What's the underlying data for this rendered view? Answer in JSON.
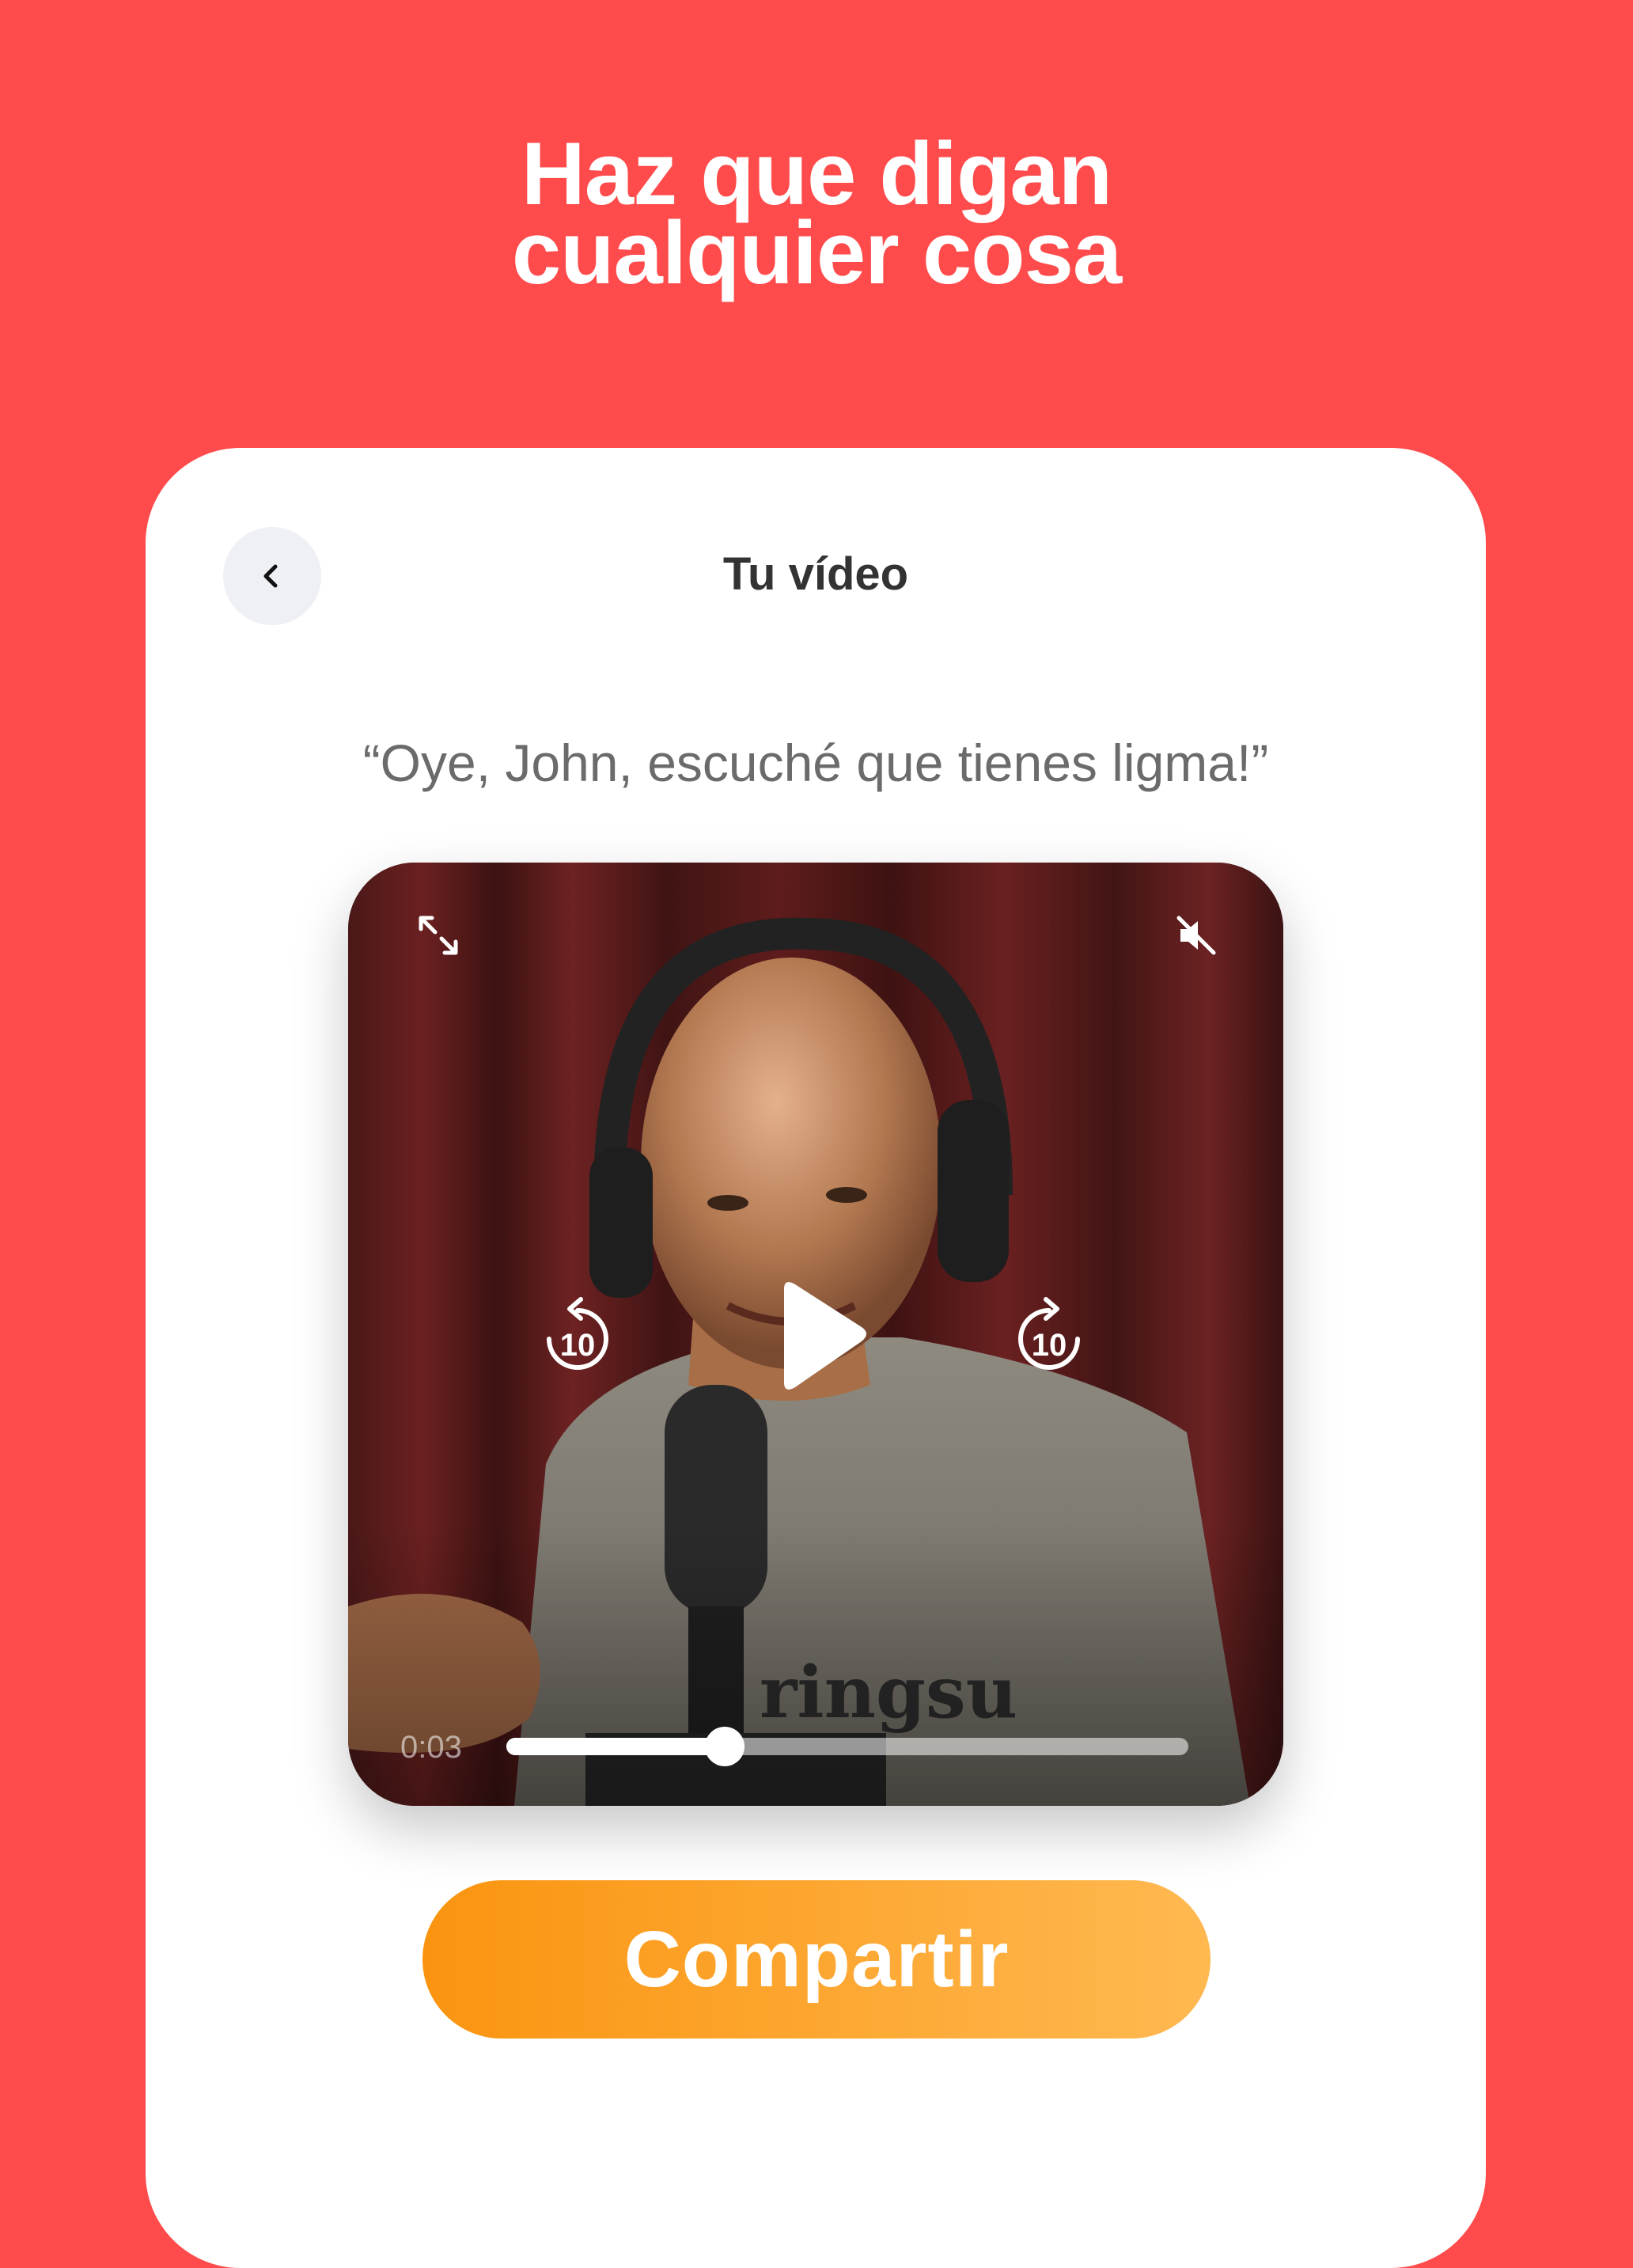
{
  "headline": {
    "line1": "Haz que digan",
    "line2": "cualquier cosa"
  },
  "card": {
    "title": "Tu vídeo",
    "quote": "“Oye, John, escuché que tienes ligma!”"
  },
  "video": {
    "time": "0:03",
    "progress": 0.32,
    "rewind_label": "10",
    "forward_label": "10",
    "muted": true
  },
  "actions": {
    "share_label": "Compartir"
  },
  "colors": {
    "background": "#FF4B4B",
    "button_start": "#FA9410",
    "button_end": "#FFB951"
  }
}
